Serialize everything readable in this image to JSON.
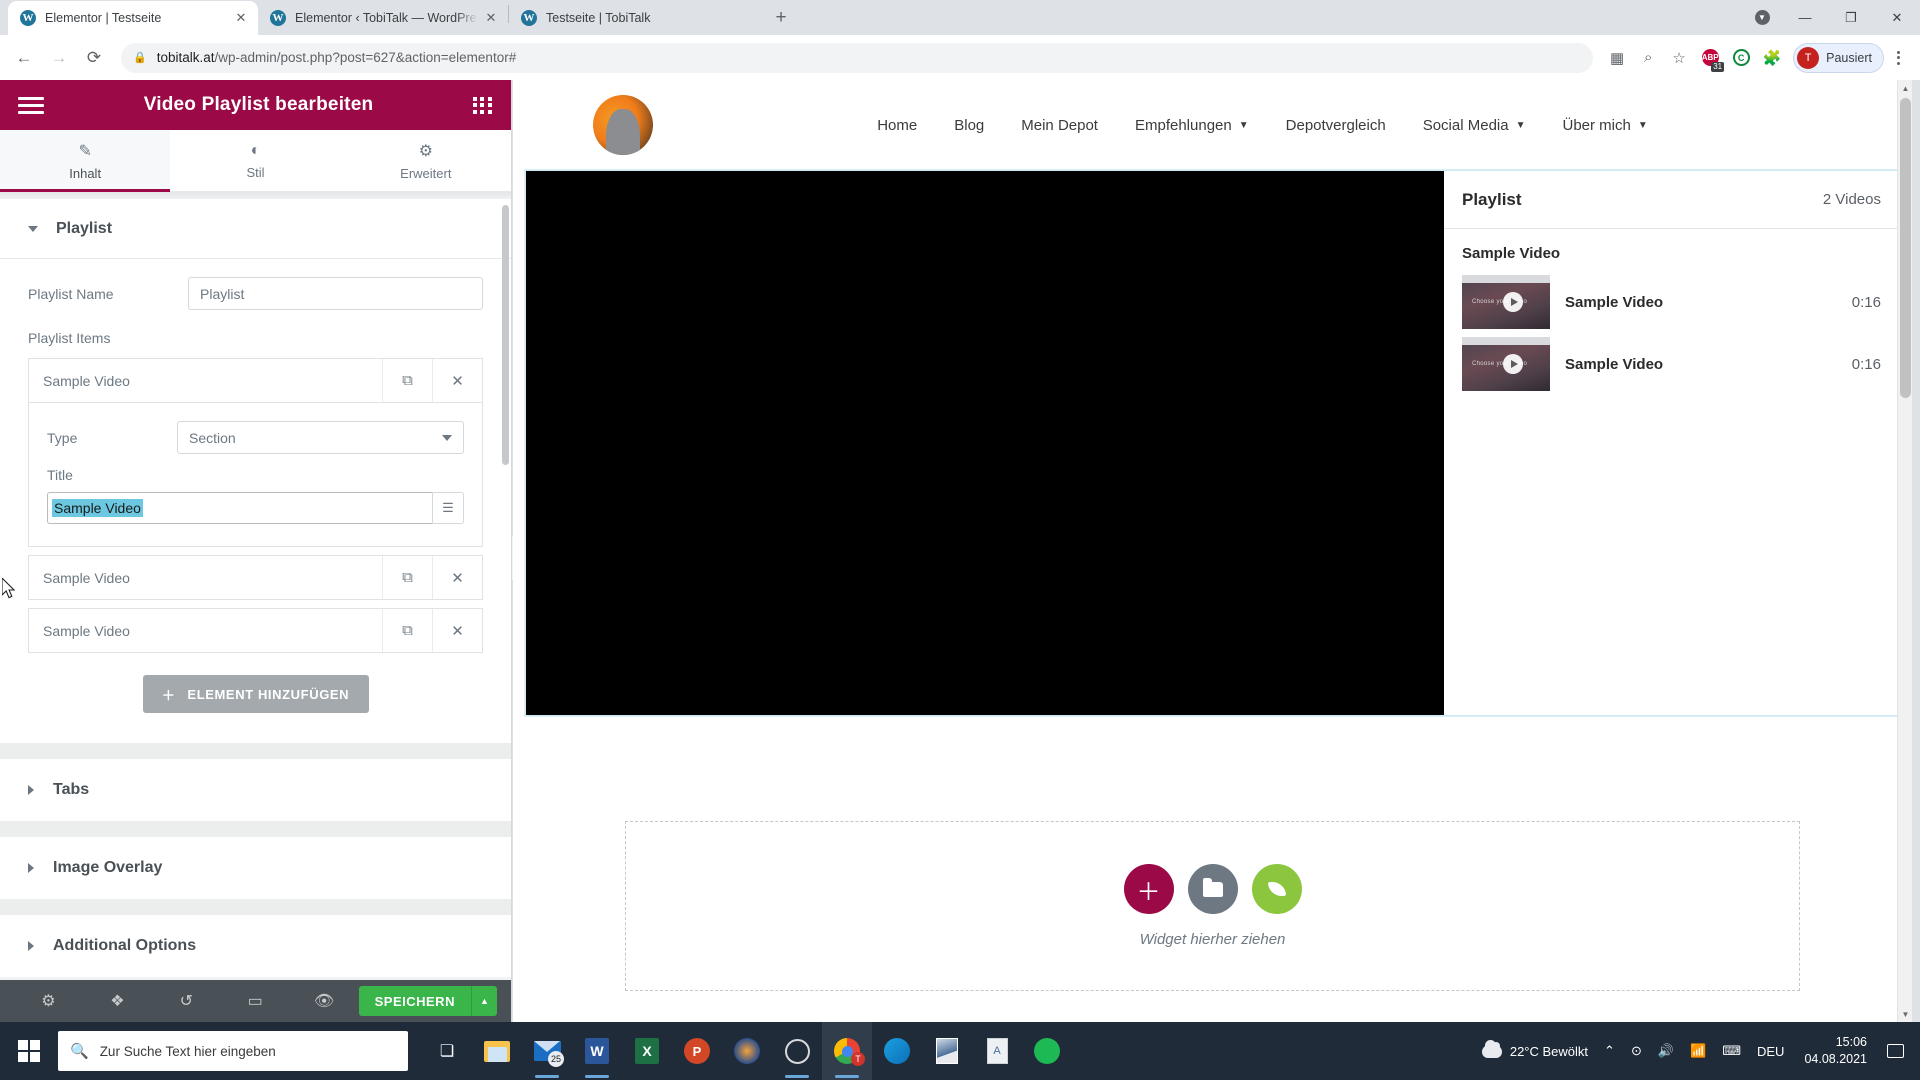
{
  "browser": {
    "tabs": [
      {
        "title": "Elementor | Testseite",
        "active": true,
        "favicon": "wordpress-icon",
        "closable": true
      },
      {
        "title": "Elementor ‹ TobiTalk — WordPre",
        "active": false,
        "favicon": "wordpress-icon",
        "closable": true
      },
      {
        "title": "Testseite | TobiTalk",
        "active": false,
        "favicon": "wordpress-icon",
        "closable": false
      }
    ],
    "new_tab_label": "+",
    "window_controls": {
      "minimize": "—",
      "maximize": "❐",
      "close": "✕",
      "download": "▼"
    },
    "nav": {
      "back": "←",
      "forward": "→",
      "reload": "⟳"
    },
    "url": {
      "domain": "tobitalk.at",
      "path": "/wp-admin/post.php?post=627&action=elementor#",
      "lock": "lock-icon"
    },
    "toolbar_icons": [
      "apps-grid-icon",
      "zoom-icon",
      "bookmark-star-icon",
      "adblock-icon",
      "colorzilla-icon",
      "extensions-puzzle-icon"
    ],
    "adblock_badge": "31",
    "adblock_label": "ABP",
    "colorzilla_label": "C",
    "profile": {
      "initial": "T",
      "label": "Pausiert"
    }
  },
  "panel": {
    "title": "Video Playlist bearbeiten",
    "menu_icon": "hamburger-icon",
    "apps_icon": "grid-apps-icon",
    "tabs": [
      {
        "label": "Inhalt",
        "icon": "pencil-icon",
        "active": true
      },
      {
        "label": "Stil",
        "icon": "contrast-half-circle-icon",
        "active": false
      },
      {
        "label": "Erweitert",
        "icon": "gear-icon",
        "active": false
      }
    ],
    "section_playlist": {
      "title": "Playlist",
      "playlist_name_label": "Playlist Name",
      "playlist_name_value": "Playlist",
      "playlist_items_label": "Playlist Items",
      "items": [
        {
          "name": "Sample Video",
          "expanded": true,
          "type_label": "Type",
          "type_value": "Section",
          "title_label": "Title",
          "title_value": "Sample Video",
          "title_selected": true
        },
        {
          "name": "Sample Video",
          "expanded": false
        },
        {
          "name": "Sample Video",
          "expanded": false
        }
      ],
      "duplicate_icon": "copy-icon",
      "remove_icon": "close-x-icon",
      "add_button_label": "ELEMENT HINZUFÜGEN",
      "add_button_icon": "plus-icon",
      "title_addon_icon": "dynamic-tags-icon"
    },
    "collapsed_sections": [
      {
        "label": "Tabs"
      },
      {
        "label": "Image Overlay"
      },
      {
        "label": "Additional Options"
      }
    ],
    "footer": {
      "icons": [
        "settings-gear-icon",
        "navigator-layers-icon",
        "history-revisions-icon",
        "responsive-mode-icon",
        "preview-eye-icon"
      ],
      "save_label": "SPEICHERN",
      "save_dropdown_icon": "chevron-up-icon"
    },
    "collapse_handle_icon": "chevron-left-icon"
  },
  "canvas": {
    "site_nav": {
      "logo": "avatar-logo",
      "links": [
        {
          "label": "Home",
          "has_dropdown": false
        },
        {
          "label": "Blog",
          "has_dropdown": false
        },
        {
          "label": "Mein Depot",
          "has_dropdown": false
        },
        {
          "label": "Empfehlungen",
          "has_dropdown": true
        },
        {
          "label": "Depotvergleich",
          "has_dropdown": false
        },
        {
          "label": "Social Media",
          "has_dropdown": true
        },
        {
          "label": "Über mich",
          "has_dropdown": true
        }
      ],
      "dropdown_icon": "chevron-down-icon"
    },
    "playlist_widget": {
      "header_title": "Playlist",
      "header_count": "2 Videos",
      "group_title": "Sample Video",
      "items": [
        {
          "title": "Sample Video",
          "duration": "0:16",
          "thumb_text": "Choose your video",
          "play_icon": "play-icon"
        },
        {
          "title": "Sample Video",
          "duration": "0:16",
          "thumb_text": "Choose your video",
          "play_icon": "play-icon"
        }
      ]
    },
    "dropzone": {
      "text": "Widget hierher ziehen",
      "buttons": [
        {
          "name": "add-element-button",
          "icon": "plus-icon",
          "color": "#9b0a46"
        },
        {
          "name": "add-template-button",
          "icon": "folder-icon",
          "color": "#6d7882"
        },
        {
          "name": "envato-kit-button",
          "icon": "leaf-icon",
          "color": "#8cc63e"
        }
      ]
    }
  },
  "taskbar": {
    "start_icon": "windows-logo-icon",
    "search_placeholder": "Zur Suche Text hier eingeben",
    "search_icon": "magnifier-icon",
    "taskview_icon": "task-view-icon",
    "apps": [
      {
        "name": "file-explorer-icon"
      },
      {
        "name": "mail-icon",
        "badge": "25"
      },
      {
        "name": "word-icon"
      },
      {
        "name": "excel-icon"
      },
      {
        "name": "powerpoint-icon"
      },
      {
        "name": "audacity-icon"
      },
      {
        "name": "obs-icon"
      },
      {
        "name": "chrome-icon",
        "active": true
      },
      {
        "name": "edge-icon"
      },
      {
        "name": "photo-editor-icon"
      },
      {
        "name": "notepad-icon"
      },
      {
        "name": "spotify-icon"
      }
    ],
    "tray": {
      "weather_icon": "cloud-icon",
      "weather": "22°C  Bewölkt",
      "overflow_icon": "chevron-up-icon",
      "camera_icon": "camera-icon",
      "volume_icon": "volume-icon",
      "wifi_icon": "wifi-icon",
      "keyboard_icon": "keyboard-icon",
      "language": "DEU",
      "time": "15:06",
      "date": "04.08.2021",
      "notification_icon": "notification-icon"
    }
  },
  "colors": {
    "elementor_accent": "#9b0a46",
    "save_green": "#39b54a",
    "panel_footer": "#495157",
    "taskbar": "#1f2b38",
    "selection_blue": "#6cc8e0"
  }
}
